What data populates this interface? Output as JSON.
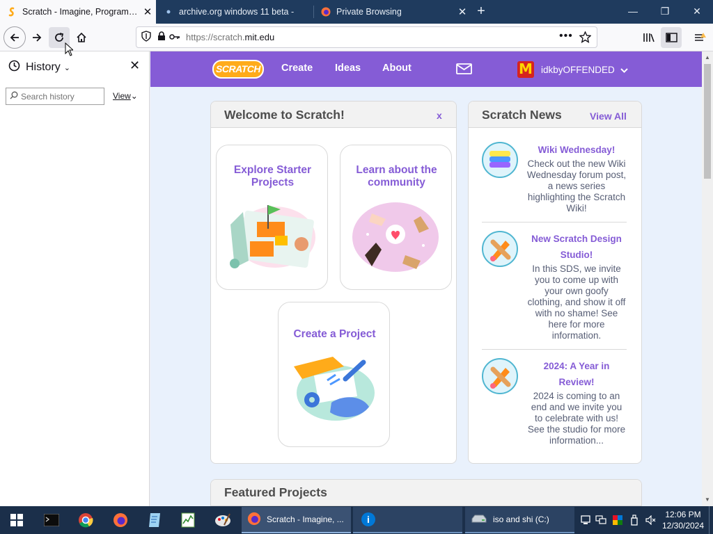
{
  "browser": {
    "tabs": [
      {
        "title": "Scratch - Imagine, Program, Sh",
        "active": true
      },
      {
        "title": "archive.org windows 11 beta -",
        "active": false
      },
      {
        "title": "Private Browsing",
        "active": false
      }
    ],
    "url_prefix": "https://scratch.",
    "url_domain": "mit.edu",
    "accent_color": "#1f3b5e"
  },
  "sidebar": {
    "title": "History",
    "search_placeholder": "Search history",
    "view_label": "View"
  },
  "scratch": {
    "logo": "SCRATCH",
    "nav": [
      "Create",
      "Ideas",
      "About"
    ],
    "username": "idkbyOFFENDED",
    "brand_color": "#855cd6",
    "welcome": {
      "title": "Welcome to Scratch!",
      "close": "x",
      "cards": [
        "Explore Starter Projects",
        "Learn about the community",
        "Create a Project"
      ]
    },
    "news": {
      "title": "Scratch News",
      "view_all": "View All",
      "items": [
        {
          "title": "Wiki Wednesday!",
          "body": "Check out the new Wiki Wednesday forum post, a news series highlighting the Scratch Wiki!"
        },
        {
          "title": "New Scratch Design Studio!",
          "body": "In this SDS, we invite you to come up with your own goofy clothing, and show it off with no shame! See here for more information."
        },
        {
          "title": "2024: A Year in Review!",
          "body": "2024 is coming to an end and we invite you to celebrate with us! See the studio for more information..."
        }
      ]
    },
    "featured_title": "Featured Projects"
  },
  "taskbar": {
    "windows": [
      {
        "label": "Scratch - Imagine, ..."
      },
      {
        "label": ""
      },
      {
        "label": "iso and shi (C:)"
      }
    ],
    "time": "12:06 PM",
    "date": "12/30/2024"
  }
}
